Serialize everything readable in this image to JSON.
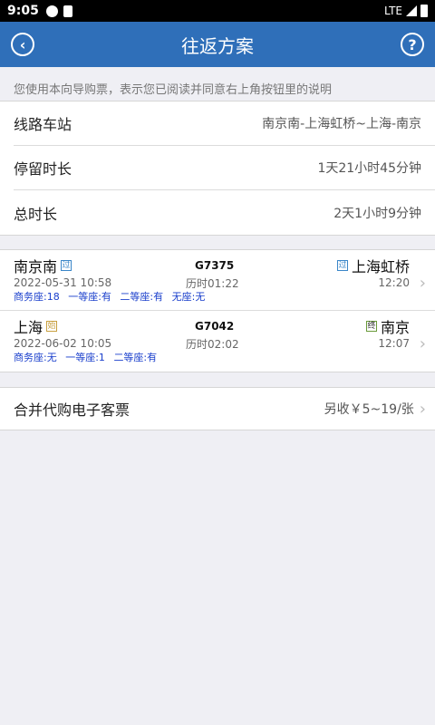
{
  "status": {
    "time": "9:05",
    "network": "LTE"
  },
  "nav": {
    "title": "往返方案",
    "back_icon": "‹",
    "help_icon": "?"
  },
  "notice": "您使用本向导购票，表示您已阅读并同意右上角按钮里的说明",
  "info": [
    {
      "label": "线路车站",
      "value": "南京南-上海虹桥~上海-南京"
    },
    {
      "label": "停留时长",
      "value": "1天21小时45分钟"
    },
    {
      "label": "总时长",
      "value": "2天1小时9分钟"
    }
  ],
  "trains": [
    {
      "from": "南京南",
      "from_tag": "过",
      "train_no": "G7375",
      "to": "上海虹桥",
      "to_tag": "过",
      "depart": "2022-05-31 10:58",
      "duration": "历时01:22",
      "arrive": "12:20",
      "seats": [
        "商务座:18",
        "一等座:有",
        "二等座:有",
        "无座:无"
      ]
    },
    {
      "from": "上海",
      "from_tag": "始",
      "train_no": "G7042",
      "to": "南京",
      "to_tag": "终",
      "depart": "2022-06-02 10:05",
      "duration": "历时02:02",
      "arrive": "12:07",
      "seats": [
        "商务座:无",
        "一等座:1",
        "二等座:有"
      ]
    }
  ],
  "combo": {
    "label": "合并代购电子客票",
    "value": "另收￥5~19/张"
  }
}
